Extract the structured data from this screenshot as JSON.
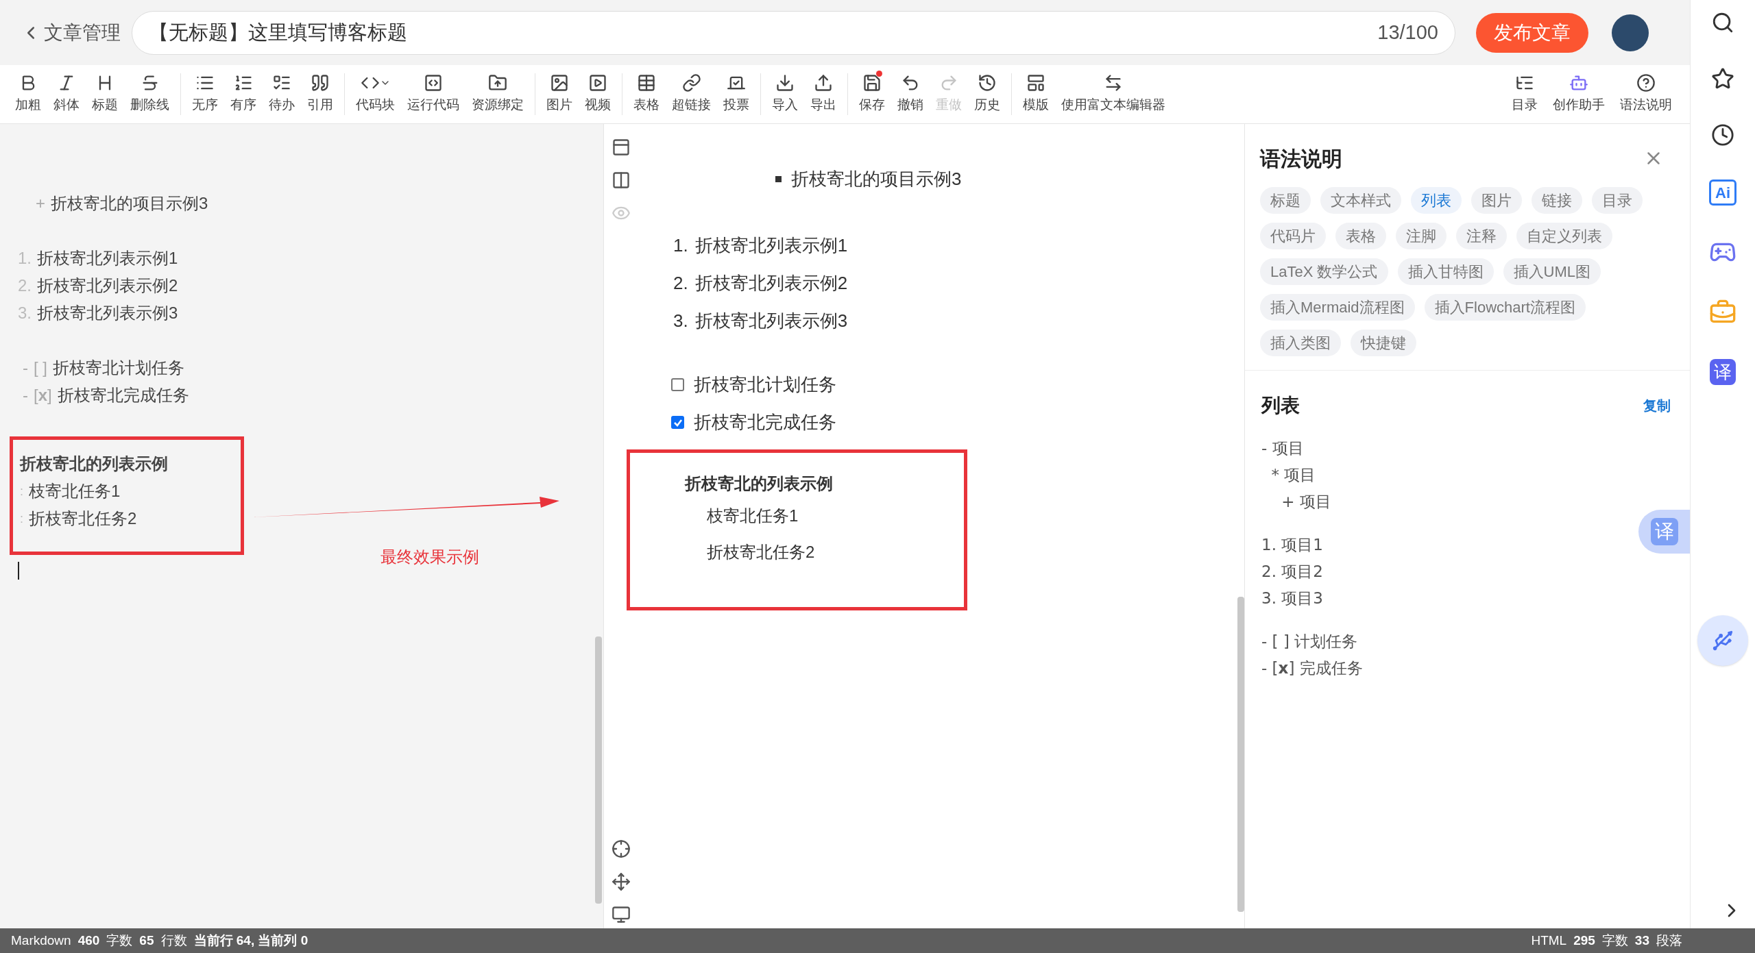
{
  "header": {
    "back_label": "文章管理",
    "title_value": "【无标题】这里填写博客标题",
    "counter": "13/100",
    "publish_button": "发布文章"
  },
  "toolbar": {
    "groups": [
      [
        {
          "label": "加粗",
          "disabled": false,
          "dot": false
        },
        {
          "label": "斜体",
          "disabled": false,
          "dot": false
        },
        {
          "label": "标题",
          "disabled": false,
          "dot": false
        },
        {
          "label": "删除线",
          "disabled": false,
          "dot": false
        }
      ],
      [
        {
          "label": "无序",
          "disabled": false,
          "dot": false
        },
        {
          "label": "有序",
          "disabled": false,
          "dot": false
        },
        {
          "label": "待办",
          "disabled": false,
          "dot": false
        },
        {
          "label": "引用",
          "disabled": false,
          "dot": false
        }
      ],
      [
        {
          "label": "代码块",
          "disabled": false,
          "dot": false
        },
        {
          "label": "运行代码",
          "disabled": false,
          "dot": false
        },
        {
          "label": "资源绑定",
          "disabled": false,
          "dot": false
        }
      ],
      [
        {
          "label": "图片",
          "disabled": false,
          "dot": false
        },
        {
          "label": "视频",
          "disabled": false,
          "dot": false
        }
      ],
      [
        {
          "label": "表格",
          "disabled": false,
          "dot": false
        },
        {
          "label": "超链接",
          "disabled": false,
          "dot": false
        },
        {
          "label": "投票",
          "disabled": false,
          "dot": false
        }
      ],
      [
        {
          "label": "导入",
          "disabled": false,
          "dot": false
        },
        {
          "label": "导出",
          "disabled": false,
          "dot": false
        }
      ],
      [
        {
          "label": "保存",
          "disabled": false,
          "dot": true
        },
        {
          "label": "撤销",
          "disabled": false,
          "dot": false
        },
        {
          "label": "重做",
          "disabled": true,
          "dot": false
        },
        {
          "label": "历史",
          "disabled": false,
          "dot": false
        }
      ],
      [
        {
          "label": "模版",
          "disabled": false,
          "dot": false
        },
        {
          "label": "使用富文本编辑器",
          "disabled": false,
          "dot": false
        }
      ]
    ],
    "right": [
      {
        "label": "目录"
      },
      {
        "label": "创作助手"
      },
      {
        "label": "语法说明"
      }
    ]
  },
  "editor": {
    "groups": [
      [
        {
          "kind": "bullet",
          "marker": "+",
          "text": "折枝寄北的项目示例3"
        }
      ],
      [
        {
          "kind": "ordered",
          "marker": "1.",
          "text": "折枝寄北列表示例1"
        },
        {
          "kind": "ordered",
          "marker": "2.",
          "text": "折枝寄北列表示例2"
        },
        {
          "kind": "ordered",
          "marker": "3.",
          "text": "折枝寄北列表示例3"
        }
      ],
      [
        {
          "kind": "task",
          "marker": "-",
          "box": "[ ]",
          "text": "折枝寄北计划任务"
        },
        {
          "kind": "task",
          "marker": "-",
          "box": "[**x**]",
          "text": "折枝寄北完成任务"
        }
      ]
    ],
    "definition": {
      "title": "折枝寄北的列表示例",
      "items": [
        {
          "marker": ":",
          "text": "枝寄北任务1"
        },
        {
          "marker": ":",
          "text": "折枝寄北任务2"
        }
      ]
    },
    "annotation": "最终效果示例"
  },
  "preview": {
    "bullet": {
      "text": "折枝寄北的项目示例3"
    },
    "ordered": [
      {
        "marker": "1.",
        "text": "折枝寄北列表示例1"
      },
      {
        "marker": "2.",
        "text": "折枝寄北列表示例2"
      },
      {
        "marker": "3.",
        "text": "折枝寄北列表示例3"
      }
    ],
    "tasks": [
      {
        "text": "折枝寄北计划任务",
        "checked": false
      },
      {
        "text": "折枝寄北完成任务",
        "checked": true
      }
    ],
    "definition": {
      "title": "折枝寄北的列表示例",
      "items": [
        "枝寄北任务1",
        "折枝寄北任务2"
      ]
    }
  },
  "help_panel": {
    "title": "语法说明",
    "tags": [
      {
        "label": "标题",
        "selected": false
      },
      {
        "label": "文本样式",
        "selected": false
      },
      {
        "label": "列表",
        "selected": true
      },
      {
        "label": "图片",
        "selected": false
      },
      {
        "label": "链接",
        "selected": false
      },
      {
        "label": "目录",
        "selected": false
      },
      {
        "label": "代码片",
        "selected": false
      },
      {
        "label": "表格",
        "selected": false
      },
      {
        "label": "注脚",
        "selected": false
      },
      {
        "label": "注释",
        "selected": false
      },
      {
        "label": "自定义列表",
        "selected": false
      },
      {
        "label": "LaTeX 数学公式",
        "selected": false
      },
      {
        "label": "插入甘特图",
        "selected": false
      },
      {
        "label": "插入UML图",
        "selected": false
      },
      {
        "label": "插入Mermaid流程图",
        "selected": false
      },
      {
        "label": "插入Flowchart流程图",
        "selected": false
      },
      {
        "label": "插入类图",
        "selected": false
      },
      {
        "label": "快捷键",
        "selected": false
      }
    ],
    "section_title": "列表",
    "copy_link": "复制",
    "code_groups": [
      [
        "- 项目",
        "  * 项目",
        "    + 项目"
      ],
      [
        "1. 项目1",
        "2. 项目2",
        "3. 项目3"
      ],
      [
        "- [ ] 计划任务",
        "- [**x**] 完成任务"
      ]
    ],
    "float_translate": "译"
  },
  "sidebar": {
    "ai_label": "Ai",
    "translate_label": "译"
  },
  "status_bar": {
    "left": [
      {
        "text": "Markdown",
        "bold": false
      },
      {
        "text": "460",
        "bold": true
      },
      {
        "text": "字数",
        "bold": false
      },
      {
        "text": "65",
        "bold": true
      },
      {
        "text": "行数",
        "bold": false
      },
      {
        "text": "当前行 64, 当前列 0",
        "bold": true
      }
    ],
    "right": [
      {
        "text": "HTML",
        "bold": false
      },
      {
        "text": "295",
        "bold": true
      },
      {
        "text": "字数",
        "bold": false
      },
      {
        "text": "33",
        "bold": true
      },
      {
        "text": "段落",
        "bold": false
      }
    ]
  }
}
